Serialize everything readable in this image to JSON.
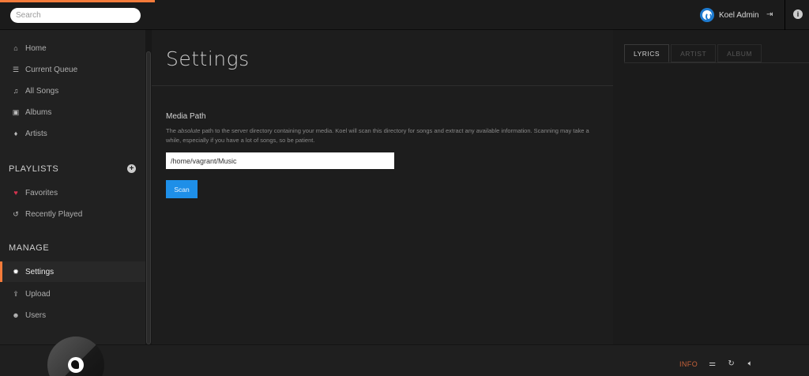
{
  "search": {
    "placeholder": "Search"
  },
  "user": {
    "name": "Koel Admin"
  },
  "sidebar": {
    "nav": [
      {
        "label": "Home",
        "icon": "home-icon",
        "glyph": "⌂"
      },
      {
        "label": "Current Queue",
        "icon": "queue-icon",
        "glyph": "☰"
      },
      {
        "label": "All Songs",
        "icon": "music-note-icon",
        "glyph": "♫"
      },
      {
        "label": "Albums",
        "icon": "album-icon",
        "glyph": "▣"
      },
      {
        "label": "Artists",
        "icon": "microphone-icon",
        "glyph": "♦"
      }
    ],
    "playlists_title": "PLAYLISTS",
    "playlists": [
      {
        "label": "Favorites",
        "icon": "heart-icon",
        "glyph": "♥"
      },
      {
        "label": "Recently Played",
        "icon": "history-icon",
        "glyph": "↺"
      }
    ],
    "manage_title": "MANAGE",
    "manage": [
      {
        "label": "Settings",
        "icon": "gear-icon",
        "glyph": "✹"
      },
      {
        "label": "Upload",
        "icon": "upload-icon",
        "glyph": "⇪"
      },
      {
        "label": "Users",
        "icon": "users-icon",
        "glyph": "☻"
      }
    ]
  },
  "main": {
    "title": "Settings",
    "media_path_label": "Media Path",
    "help_prefix": "The ",
    "help_emphasis": "absolute",
    "help_suffix": " path to the server directory containing your media. Koel will scan this directory for songs and extract any available information. Scanning may take a while, especially if you have a lot of songs, so be patient.",
    "media_path_value": "/home/vagrant/Music",
    "scan_label": "Scan"
  },
  "extra": {
    "tabs": [
      {
        "label": "LYRICS",
        "active": true
      },
      {
        "label": "ARTIST",
        "active": false
      },
      {
        "label": "ALBUM",
        "active": false
      }
    ]
  },
  "footer": {
    "info_label": "INFO"
  },
  "colors": {
    "accent": "#f47b3a",
    "primary_button": "#1e8fe8",
    "favorite": "#d6334f",
    "background": "#181818"
  }
}
